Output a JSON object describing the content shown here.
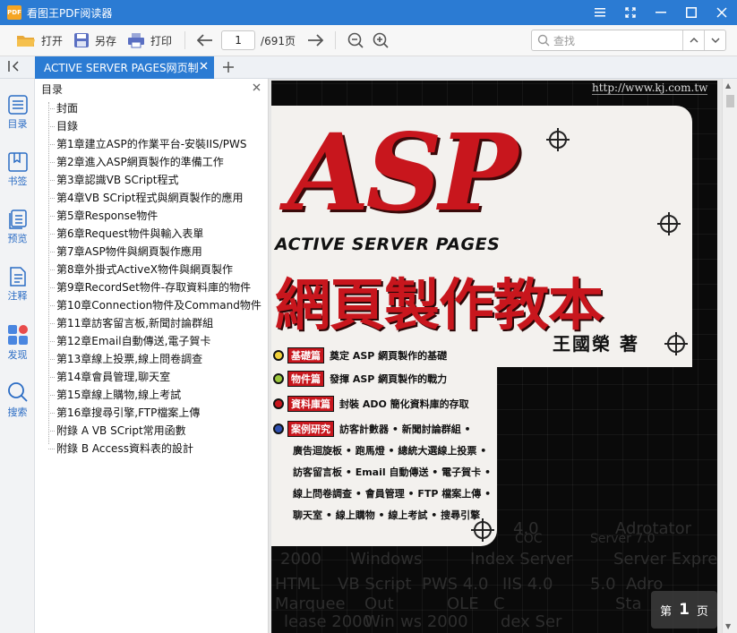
{
  "app": {
    "title": "看图王PDF阅读器",
    "logo_text": "PDF"
  },
  "toolbar": {
    "open_label": "打开",
    "saveas_label": "另存",
    "print_label": "打印",
    "current_page": "1",
    "total_pages": "/691页",
    "search_placeholder": "查找"
  },
  "tab": {
    "label": "ACTIVE SERVER PAGES网页制"
  },
  "rail": {
    "items": [
      {
        "label": "目录",
        "icon": "toc-icon"
      },
      {
        "label": "书签",
        "icon": "bookmark-icon"
      },
      {
        "label": "预览",
        "icon": "preview-icon"
      },
      {
        "label": "注释",
        "icon": "annotation-icon"
      },
      {
        "label": "发现",
        "icon": "discover-icon"
      },
      {
        "label": "搜索",
        "icon": "search-icon"
      }
    ]
  },
  "outline": {
    "title": "目录",
    "items": [
      "封面",
      "目錄",
      "第1章建立ASP的作業平台-安裝IIS/PWS",
      "第2章進入ASP網頁製作的準備工作",
      "第3章認識VB SCript程式",
      "第4章VB SCript程式與網頁製作的應用",
      "第5章Response物件",
      "第6章Request物件與輸入表單",
      "第7章ASP物件與網頁製作應用",
      "第8章外掛式ActiveX物件與網頁製作",
      "第9章RecordSet物件-存取資料庫的物件",
      "第10章Connection物件及Command物件",
      "第11章訪客留言板,新聞討論群組",
      "第12章Email自動傳送,電子賀卡",
      "第13章線上投票,線上問卷調查",
      "第14章會員管理,聊天室",
      "第15章線上購物,線上考試",
      "第16章搜尋引擎,FTP檔案上傳",
      "附錄 A VB SCript常用函數",
      "附錄 B Access資料表的設計"
    ]
  },
  "cover": {
    "url": "http://www.kj.com.tw",
    "title": "ASP",
    "subtitle": "ACTIVE SERVER PAGES",
    "cn_title": "網頁製作教本",
    "author": "王國榮 著",
    "bullets": [
      {
        "tag": "基礎篇",
        "text": "奠定 ASP 網頁製作的基礎"
      },
      {
        "tag": "物件篇",
        "text": "發揮 ASP 網頁製作的戰力"
      },
      {
        "tag": "資料庫篇",
        "text": "封裝 ADO 簡化資料庫的存取"
      },
      {
        "tag": "案例研究",
        "text": "訪客計數器 • 新聞討論群組 •"
      }
    ],
    "features": [
      "廣告迴旋板 • 跑馬燈 • 總統大選線上投票 •",
      "訪客留言板 • Email 自動傳送 • 電子賀卡 •",
      "線上問卷調查 • 會員管理 • FTP 檔案上傳 •",
      "聊天室 • 線上購物 • 線上考試 • 搜尋引擎"
    ],
    "bg_text": [
      "4.0",
      "Adrotator",
      "COC",
      "Server 7.0",
      "2000",
      "Windows",
      "Index Server",
      "Server Expres",
      "HTML",
      "VB Script",
      "PWS 4.0",
      "IIS 4.0",
      "5.0",
      "Adro",
      "Marquee",
      "Out",
      "OLE",
      "C",
      "Sta",
      "lease 2000",
      "Win",
      "ws 2000",
      "dex Ser"
    ]
  },
  "page_indicator": {
    "prefix": "第",
    "number": "1",
    "suffix": "页"
  },
  "colors": {
    "accent": "#2b7bd3",
    "cover_red": "#c8161d"
  }
}
